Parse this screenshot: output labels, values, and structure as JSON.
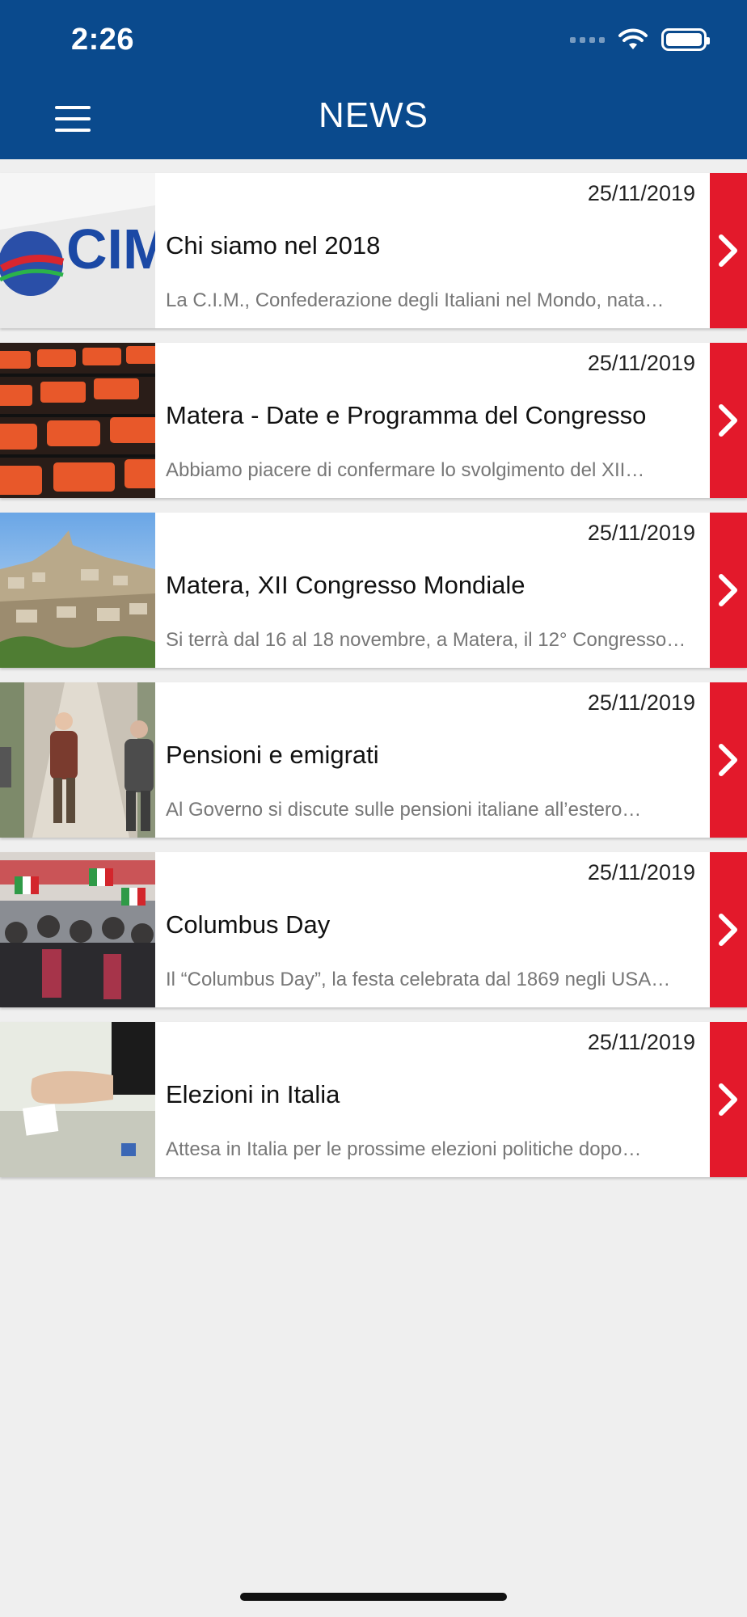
{
  "status_bar": {
    "time": "2:26"
  },
  "header": {
    "title": "NEWS"
  },
  "news": [
    {
      "date": "25/11/2019",
      "title": "Chi siamo nel 2018",
      "excerpt": "La C.I.M., Confederazione degli Italiani nel Mondo, nata…",
      "thumb_text": "CIM"
    },
    {
      "date": "25/11/2019",
      "title": "Matera - Date e Programma del Congresso",
      "excerpt": "Abbiamo piacere di confermare lo svolgimento del XII…"
    },
    {
      "date": "25/11/2019",
      "title": "Matera, XII Congresso Mondiale",
      "excerpt": "Si terrà dal 16 al 18 novembre, a Matera, il 12° Congresso…"
    },
    {
      "date": "25/11/2019",
      "title": "Pensioni e emigrati",
      "excerpt": "Al Governo si discute sulle pensioni italiane all’estero…"
    },
    {
      "date": "25/11/2019",
      "title": "Columbus Day",
      "excerpt": "Il “Columbus Day”, la festa celebrata dal 1869 negli USA…"
    },
    {
      "date": "25/11/2019",
      "title": "Elezioni in Italia",
      "excerpt": "Attesa in Italia per le prossime elezioni politiche dopo…"
    }
  ],
  "colors": {
    "header": "#0a4a8d",
    "accent": "#e3192b",
    "background": "#efefef"
  },
  "icons": [
    "menu-icon",
    "wifi-icon",
    "battery-icon",
    "signal-icon",
    "chevron-right-icon"
  ]
}
